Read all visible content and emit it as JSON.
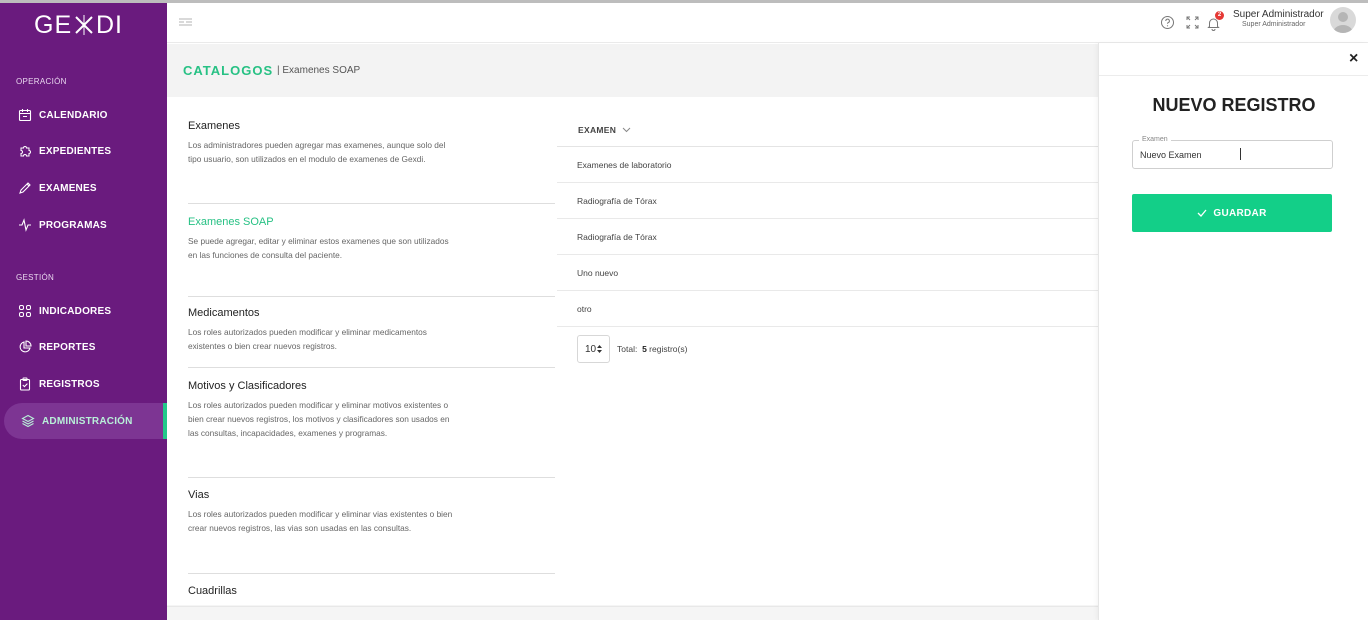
{
  "app": {
    "logo": "GEXDI"
  },
  "sidebar": {
    "sections": [
      {
        "title": "OPERACIÓN",
        "items": [
          {
            "label": "CALENDARIO",
            "icon": "calendar-icon"
          },
          {
            "label": "EXPEDIENTES",
            "icon": "puzzle-icon"
          },
          {
            "label": "EXAMENES",
            "icon": "pencil-ruler-icon"
          },
          {
            "label": "PROGRAMAS",
            "icon": "pulse-icon"
          }
        ]
      },
      {
        "title": "GESTIÓN",
        "items": [
          {
            "label": "INDICADORES",
            "icon": "grid-icon"
          },
          {
            "label": "REPORTES",
            "icon": "pie-chart-icon"
          },
          {
            "label": "REGISTROS",
            "icon": "clipboard-check-icon"
          },
          {
            "label": "ADMINISTRACIÓN",
            "icon": "layers-icon",
            "active": true
          }
        ]
      }
    ]
  },
  "header": {
    "notifications_count": "2",
    "user_name": "Super Administrador",
    "user_role": "Super Administrador"
  },
  "breadcrumb": {
    "main": "CATALOGOS",
    "sub": "| Examenes SOAP"
  },
  "catalogs": [
    {
      "title": "Examenes",
      "desc": "Los administradores pueden agregar mas examenes, aunque solo del tipo usuario, son utilizados en el modulo de examenes de Gexdi."
    },
    {
      "title": "Examenes SOAP",
      "desc": "Se puede agregar, editar y eliminar estos examenes que son utilizados en las funciones de consulta del paciente.",
      "active": true
    },
    {
      "title": "Medicamentos",
      "desc": "Los roles autorizados pueden modificar y eliminar medicamentos existentes o bien crear nuevos registros."
    },
    {
      "title": "Motivos y Clasificadores",
      "desc": "Los roles autorizados pueden modificar y eliminar motivos existentes o bien crear nuevos registros, los motivos y clasificadores son usados en las consultas, incapacidades, examenes y programas."
    },
    {
      "title": "Vias",
      "desc": "Los roles autorizados pueden modificar y eliminar vias existentes o bien crear nuevos registros, las vias son usadas en las consultas."
    },
    {
      "title": "Cuadrillas",
      "desc": ""
    }
  ],
  "table": {
    "column": "EXAMEN",
    "rows": [
      "Examenes de laboratorio",
      "Radiografía de Tórax",
      "Radiografía de Tórax",
      "Uno nuevo",
      "otro"
    ],
    "page_size": "10",
    "total_label": "Total:",
    "total_value": "5",
    "total_suffix": "registro(s)"
  },
  "drawer": {
    "close": "×",
    "title": "NUEVO REGISTRO",
    "field_label": "Examen",
    "field_value": "Nuevo Examen",
    "save_label": "GUARDAR"
  },
  "colors": {
    "sidebar": "#6a1b7e",
    "accent": "#13cf88",
    "badge": "#e53935"
  }
}
